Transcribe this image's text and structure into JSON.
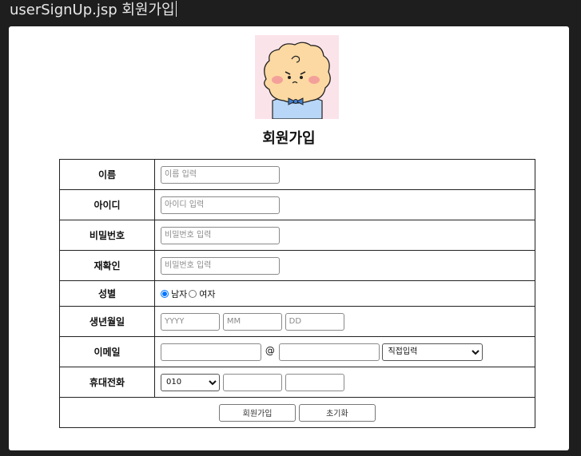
{
  "window": {
    "title": "userSignUp.jsp 회원가입"
  },
  "form": {
    "title": "회원가입",
    "name": {
      "label": "이름",
      "placeholder": "이름 입력",
      "value": ""
    },
    "userid": {
      "label": "아이디",
      "placeholder": "아이디 입력",
      "value": ""
    },
    "password": {
      "label": "비밀번호",
      "placeholder": "비밀번호 입력",
      "value": ""
    },
    "password_confirm": {
      "label": "재확인",
      "placeholder": "비밀번호 입력",
      "value": ""
    },
    "gender": {
      "label": "성별",
      "options": [
        "남자",
        "여자"
      ],
      "selected": "남자"
    },
    "birth": {
      "label": "생년월일",
      "year_placeholder": "YYYY",
      "month_placeholder": "MM",
      "day_placeholder": "DD"
    },
    "email": {
      "label": "이메일",
      "at": "@",
      "domain_select": "직접입력"
    },
    "phone": {
      "label": "휴대전화",
      "prefix": "010"
    },
    "buttons": {
      "submit": "회원가입",
      "reset": "초기화"
    }
  },
  "avatar": {
    "icon": "cartoon-bear-avatar",
    "background": "#fde6ec"
  }
}
